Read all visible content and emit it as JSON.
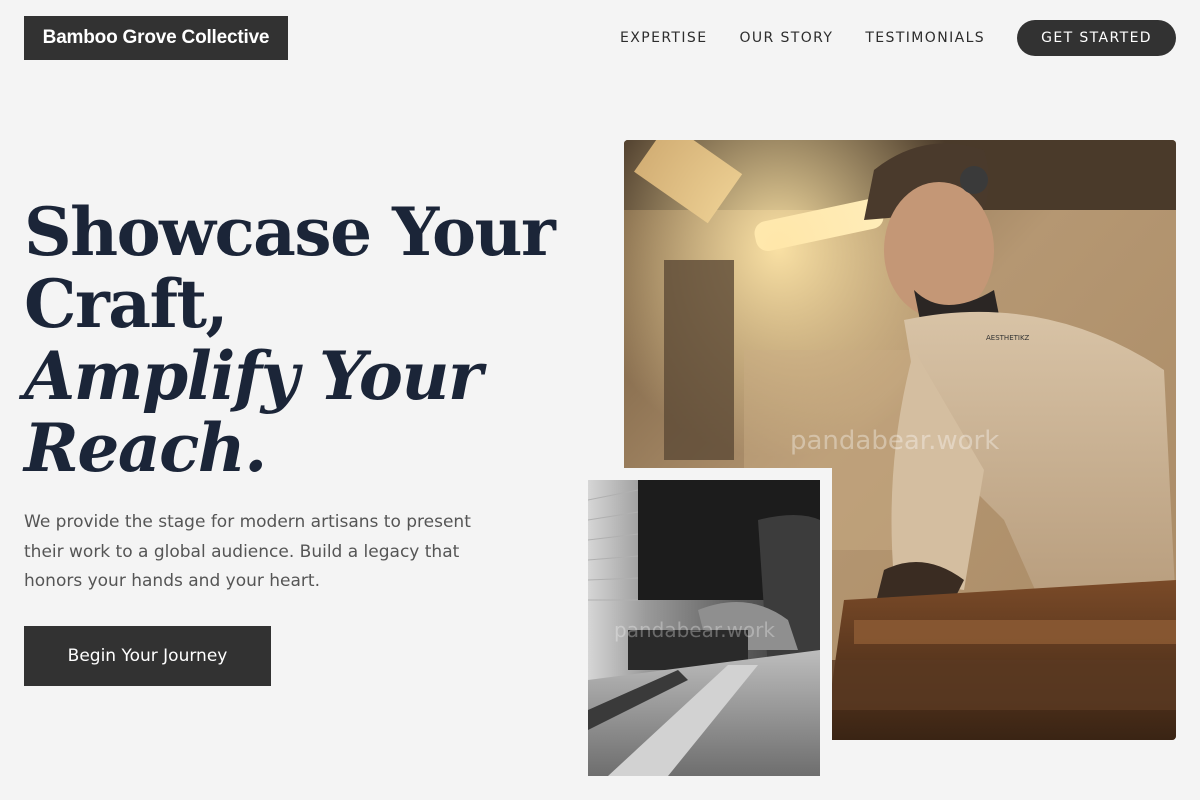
{
  "brand": {
    "name": "Bamboo Grove Collective"
  },
  "nav": {
    "items": [
      {
        "label": "EXPERTISE"
      },
      {
        "label": "OUR STORY"
      },
      {
        "label": "TESTIMONIALS"
      }
    ],
    "cta_label": "GET STARTED"
  },
  "hero": {
    "title_line1": "Showcase Your",
    "title_line2": "Craft,",
    "title_line3": "Amplify Your",
    "title_line4": "Reach.",
    "description": "We provide the stage for modern artisans to present their work to a global audience. Build a legacy that honors your hands and your heart.",
    "button_label": "Begin Your Journey"
  },
  "images": {
    "main_watermark": "pandabear.work",
    "small_watermark": "pandabear.work"
  }
}
